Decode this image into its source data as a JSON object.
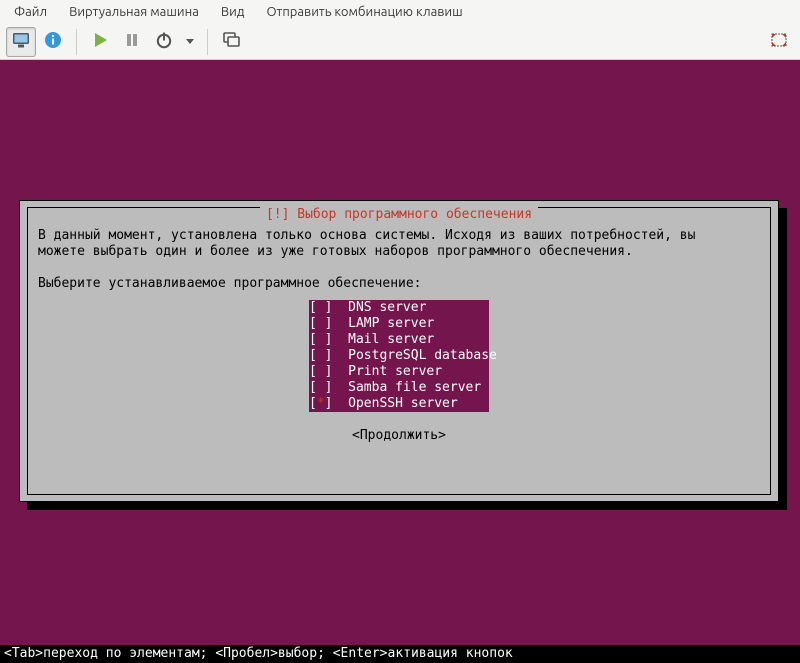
{
  "menubar": {
    "items": [
      "Файл",
      "Виртуальная машина",
      "Вид",
      "Отправить комбинацию клавиш"
    ]
  },
  "toolbar": {
    "monitor": "monitor-icon",
    "info": "info-icon",
    "play": "play-icon",
    "pause": "pause-icon",
    "power": "power-icon",
    "dropdown": "dropdown-icon",
    "windows": "windows-icon",
    "fullscreen": "fullscreen-icon"
  },
  "dialog": {
    "title": "[!] Выбор программного обеспечения",
    "para": "В данный момент, установлена только основа системы. Исходя из ваших потребностей, вы\nможете выбрать один и более из уже готовых наборов программного обеспечения.",
    "prompt": "Выберите устанавливаемое программное обеспечение:",
    "items": [
      {
        "checked": false,
        "label": "DNS server"
      },
      {
        "checked": false,
        "label": "LAMP server"
      },
      {
        "checked": false,
        "label": "Mail server"
      },
      {
        "checked": false,
        "label": "PostgreSQL database"
      },
      {
        "checked": false,
        "label": "Print server"
      },
      {
        "checked": false,
        "label": "Samba file server"
      },
      {
        "checked": true,
        "label": "OpenSSH server"
      }
    ],
    "continue": "<Продолжить>"
  },
  "bottom_hint": "<Tab>переход по элементам; <Пробел>выбор; <Enter>активация кнопок"
}
